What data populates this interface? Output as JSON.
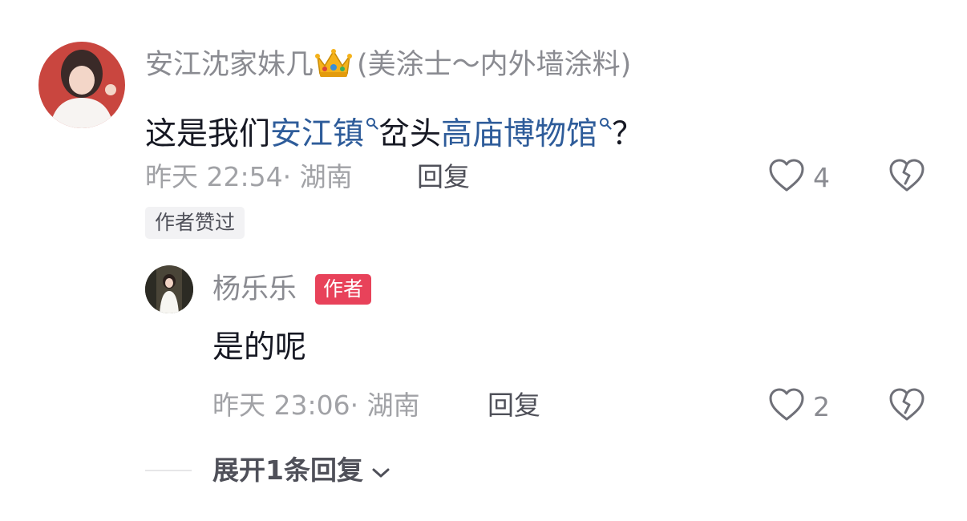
{
  "comment": {
    "username": "安江沈家妹几",
    "username_suffix": "(美涂士～内外墙涂料)",
    "crown_icon": "crown-icon",
    "content_parts": [
      "这是我们",
      "安江镇",
      "岔头",
      "高庙博物馆",
      "？"
    ],
    "meta": "昨天 22:54· 湖南",
    "reply_label": "回复",
    "like_count": "4",
    "author_liked_tag": "作者赞过"
  },
  "reply": {
    "username": "杨乐乐",
    "author_badge": "作者",
    "content": "是的呢",
    "meta": "昨天 23:06· 湖南",
    "reply_label": "回复",
    "like_count": "2"
  },
  "expand": {
    "label": "展开1条回复"
  },
  "colors": {
    "keyword": "#2e5c9a",
    "author_badge": "#e8425a",
    "secondary_text": "#8a8b91"
  }
}
